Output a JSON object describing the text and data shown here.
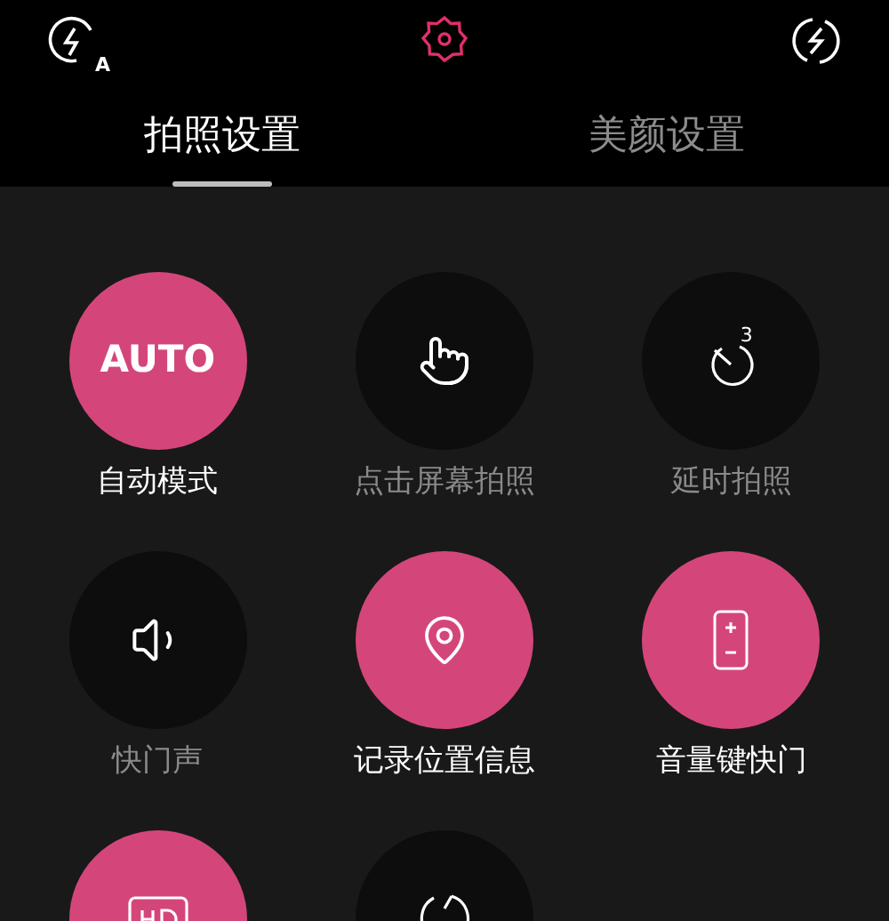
{
  "top_bar": {
    "flash_badge": "A"
  },
  "tabs": [
    {
      "label": "拍照设置",
      "selected": true
    },
    {
      "label": "美颜设置",
      "selected": false
    }
  ],
  "options": [
    {
      "kind": "text",
      "glyph": "AUTO",
      "label": "自动模式",
      "on": true
    },
    {
      "kind": "touch",
      "label": "点击屏幕拍照",
      "on": false
    },
    {
      "kind": "timer",
      "glyph": "3",
      "label": "延时拍照",
      "on": false
    },
    {
      "kind": "sound",
      "label": "快门声",
      "on": false
    },
    {
      "kind": "location",
      "label": "记录位置信息",
      "on": true
    },
    {
      "kind": "volume-key",
      "label": "音量键快门",
      "on": true
    },
    {
      "kind": "hd",
      "on": true
    },
    {
      "kind": "refresh",
      "on": false
    }
  ]
}
